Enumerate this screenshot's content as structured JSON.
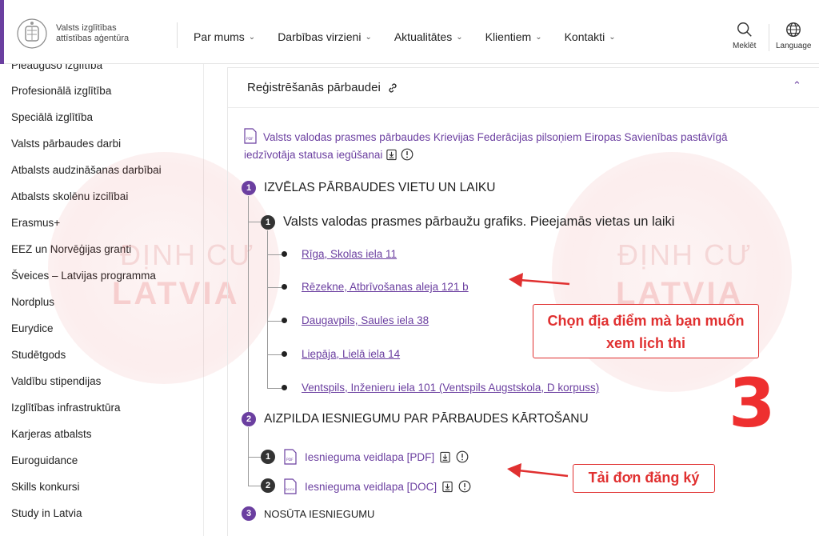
{
  "header": {
    "logo_text": "Valsts izglītības attīstības aģentūra",
    "nav": [
      "Par mums",
      "Darbības virzieni",
      "Aktualitātes",
      "Klientiem",
      "Kontakti"
    ],
    "search_label": "Meklēt",
    "language_label": "Language"
  },
  "sidebar": {
    "items": [
      "Pieaugušo izglītība",
      "Profesionālā izglītība",
      "Speciālā izglītība",
      "Valsts pārbaudes darbi",
      "Atbalsts audzināšanas darbībai",
      "Atbalsts skolēnu izcilībai",
      "Erasmus+",
      "EEZ un Norvēģijas granti",
      "Šveices – Latvijas programma",
      "Nordplus",
      "Eurydice",
      "Studētgods",
      "Valdību stipendijas",
      "Izglītības infrastruktūra",
      "Karjeras atbalsts",
      "Euroguidance",
      "Skills konkursi",
      "Study in Latvia"
    ]
  },
  "watermark": {
    "line1": "ĐỊNH CƯ",
    "line2": "LATVIA"
  },
  "panel": {
    "title": "Reģistrēšanās pārbaudei",
    "pdf_link": "Valsts valodas prasmes pārbaudes Krievijas Federācijas pilsoņiem Eiropas Savienības pastāvīgā iedzīvotāja statusa iegūšanai",
    "step1": {
      "num": "1",
      "title": "IZVĒLAS PĀRBAUDES VIETU UN LAIKU"
    },
    "sub1": {
      "num": "1",
      "title": "Valsts valodas prasmes pārbaužu grafiks. Pieejamās vietas un laiki"
    },
    "locations": [
      "Rīga, Skolas iela 11",
      "Rēzekne, Atbrīvošanas aleja 121 b",
      "Daugavpils, Saules iela 38",
      "Liepāja, Lielā iela 14",
      "Ventspils, Inženieru iela 101 (Ventspils Augstskola, D korpuss)"
    ],
    "step2": {
      "num": "2",
      "title": "AIZPILDA IESNIEGUMU PAR PĀRBAUDES KĀRTOŠANU"
    },
    "docs": [
      {
        "num": "1",
        "label": "Iesnieguma veidlapa [PDF]",
        "type": "PDF"
      },
      {
        "num": "2",
        "label": "Iesnieguma veidlapa [DOC]",
        "type": "DOCX"
      }
    ],
    "step3": {
      "num": "3",
      "title": "NOSŪTA IESNIEGUMU"
    }
  },
  "annotations": {
    "callout1": "Chọn địa điểm mà bạn muốn xem lịch thi",
    "callout2": "Tải đơn đăng ký",
    "big_number": "3"
  },
  "colors": {
    "accent": "#6b3fa0",
    "annotation": "#e03030"
  }
}
